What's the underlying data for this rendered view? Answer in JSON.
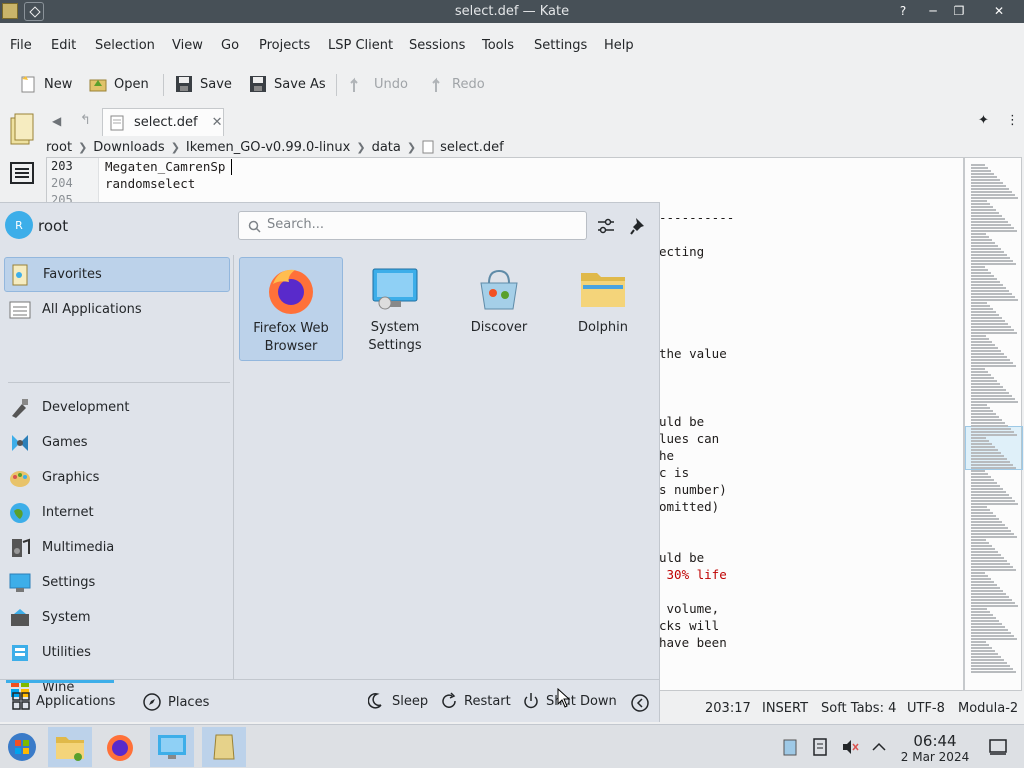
{
  "window": {
    "title": "select.def — Kate"
  },
  "menu": [
    "File",
    "Edit",
    "Selection",
    "View",
    "Go",
    "Projects",
    "LSP Client",
    "Sessions",
    "Tools",
    "Settings",
    "Help"
  ],
  "toolbar": {
    "new": "New",
    "open": "Open",
    "save": "Save",
    "save_as": "Save As",
    "undo": "Undo",
    "redo": "Redo"
  },
  "tab": {
    "label": "select.def"
  },
  "breadcrumb": [
    "root",
    "Downloads",
    "Ikemen_GO-v0.99.0-linux",
    "data",
    "select.def"
  ],
  "editor": {
    "lines": [
      {
        "no": "203",
        "text": "Megaten_CamrenSp"
      },
      {
        "no": "204",
        "text": "randomselect"
      },
      {
        "no": "205",
        "text": ""
      }
    ],
    "visible_fragments": [
      "----------",
      "ecting",
      "the value",
      "uld be",
      "lues can",
      "he",
      "c is",
      "s number)",
      "omitted)",
      "uld be",
      " 30% life",
      " volume,",
      "cks will",
      "have been"
    ]
  },
  "status": {
    "position": "203:17",
    "mode": "INSERT",
    "tabs": "Soft Tabs: 4",
    "encoding": "UTF-8",
    "syntax": "Modula-2"
  },
  "launcher": {
    "user": "root",
    "avatar_letter": "R",
    "search_placeholder": "Search...",
    "categories": [
      "Favorites",
      "All Applications",
      "Development",
      "Games",
      "Graphics",
      "Internet",
      "Multimedia",
      "Settings",
      "System",
      "Utilities",
      "Wine"
    ],
    "apps": [
      "Firefox Web Browser",
      "System Settings",
      "Discover",
      "Dolphin"
    ],
    "footer": {
      "applications": "Applications",
      "places": "Places",
      "sleep": "Sleep",
      "restart": "Restart",
      "shutdown": "Shut Down"
    }
  },
  "clock": {
    "time": "06:44",
    "date": "2 Mar 2024"
  }
}
